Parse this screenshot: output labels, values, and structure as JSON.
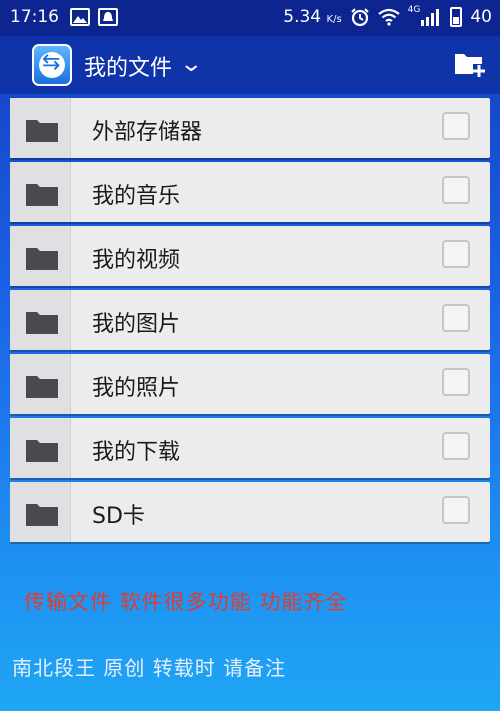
{
  "status_bar": {
    "time": "17:16",
    "speed": "5.34",
    "speed_unit": "K/s",
    "network": "4G",
    "battery": "40",
    "icons": [
      "image-icon",
      "notification-icon",
      "alarm-icon",
      "wifi-icon",
      "signal-icon",
      "battery-icon"
    ]
  },
  "app_bar": {
    "title": "我的文件",
    "logo_icon": "teamviewer-logo",
    "dropdown_icon": "chevron-down-icon",
    "action_icon": "new-folder-icon"
  },
  "folders": [
    {
      "label": "外部存储器"
    },
    {
      "label": "我的音乐"
    },
    {
      "label": "我的视频"
    },
    {
      "label": "我的图片"
    },
    {
      "label": "我的照片"
    },
    {
      "label": "我的下载"
    },
    {
      "label": "SD卡"
    }
  ],
  "captions": {
    "red": "传输文件 软件很多功能 功能齐全",
    "white": "南北段王 原创 转载时 请备注"
  },
  "colors": {
    "status_bar": "#0c2590",
    "app_bar": "#0f33a8",
    "row_bg": "#ececee",
    "caption_red": "#e23b2f"
  }
}
